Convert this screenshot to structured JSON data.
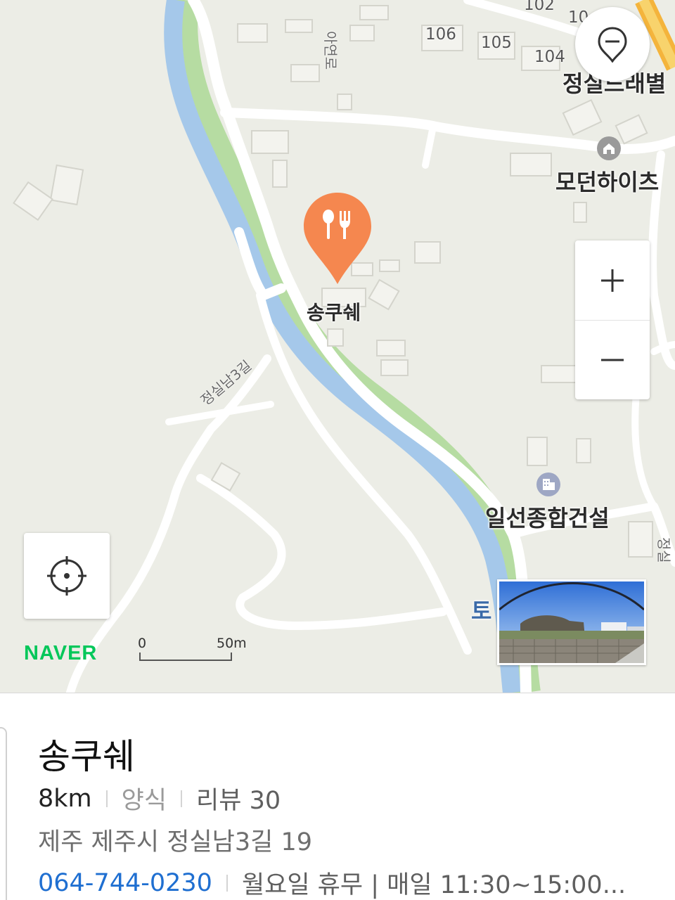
{
  "map": {
    "labels": {
      "building_102": "102",
      "building_10x": "10",
      "building_106": "106",
      "building_105": "105",
      "building_104": "104",
      "apt_complex": "정실드래별",
      "modern_heights": "모던하이츠",
      "ilseon": "일선종합건설",
      "to_partial": "토",
      "road_jeongsilnam3gil": "정실남3길",
      "road_ayeon": "아연로",
      "road_right_partial": "정실"
    },
    "pin_label": "송쿠쉐",
    "pin_icon": "restaurant-fork-spoon-icon",
    "pin_color": "#f5874f",
    "river_color": "#a5c8ea",
    "bank_color": "#b6dca2",
    "logo": "NAVER",
    "scale": {
      "zero": "0",
      "max": "50m"
    },
    "controls": {
      "zoom_in_icon": "plus-icon",
      "zoom_out_icon": "minus-icon",
      "filter_icon": "location-filter-icon",
      "locate_icon": "crosshair-icon"
    }
  },
  "place": {
    "name": "송쿠쉐",
    "distance": "8km",
    "category": "양식",
    "reviews": "리뷰 30",
    "address": "제주 제주시 정실남3길 19",
    "phone": "064-744-0230",
    "hours": "월요일 휴무 | 매일 11:30~15:00..."
  }
}
